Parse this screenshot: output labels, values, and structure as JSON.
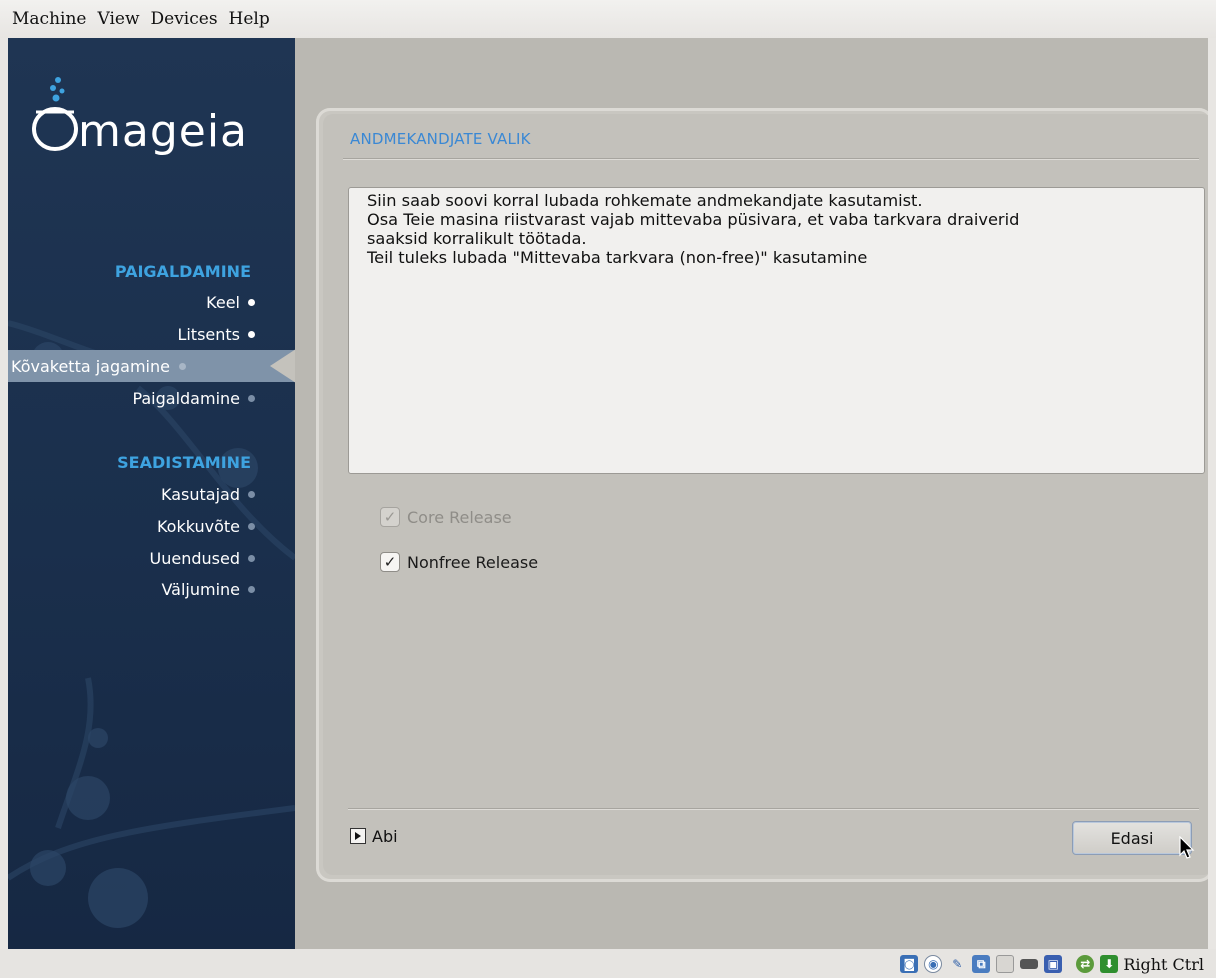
{
  "host_menu": [
    "Machine",
    "View",
    "Devices",
    "Help"
  ],
  "brand": "mageia",
  "sidebar": {
    "section1": "PAIGALDAMINE",
    "steps1": [
      {
        "label": "Keel",
        "state": "done"
      },
      {
        "label": "Litsents",
        "state": "done"
      },
      {
        "label": "Kõvaketta jagamine",
        "state": "current"
      },
      {
        "label": "Paigaldamine",
        "state": "pending"
      }
    ],
    "section2": "SEADISTAMINE",
    "steps2": [
      {
        "label": "Kasutajad",
        "state": "pending"
      },
      {
        "label": "Kokkuvõte",
        "state": "pending"
      },
      {
        "label": "Uuendused",
        "state": "pending"
      },
      {
        "label": "Väljumine",
        "state": "pending"
      }
    ]
  },
  "dialog": {
    "title": "ANDMEKANDJATE VALIK",
    "description": "Siin saab soovi korral lubada rohkemate andmekandjate kasutamist.\nOsa Teie masina riistvarast vajab mittevaba püsivara, et vaba tarkvara draiverid\nsaaksid korralikult töötada.\nTeil tuleks lubada \"Mittevaba tarkvara (non-free)\" kasutamine",
    "options": [
      {
        "label": "Core Release",
        "checked": true,
        "enabled": false
      },
      {
        "label": "Nonfree Release",
        "checked": true,
        "enabled": true
      }
    ],
    "help_label": "Abi",
    "next_label": "Edasi"
  },
  "statusbar": {
    "host_key": "Right Ctrl"
  },
  "colors": {
    "sidebar_bg": "#1f3553",
    "section_heading": "#3ea3e0",
    "dialog_title": "#3a88d4"
  }
}
